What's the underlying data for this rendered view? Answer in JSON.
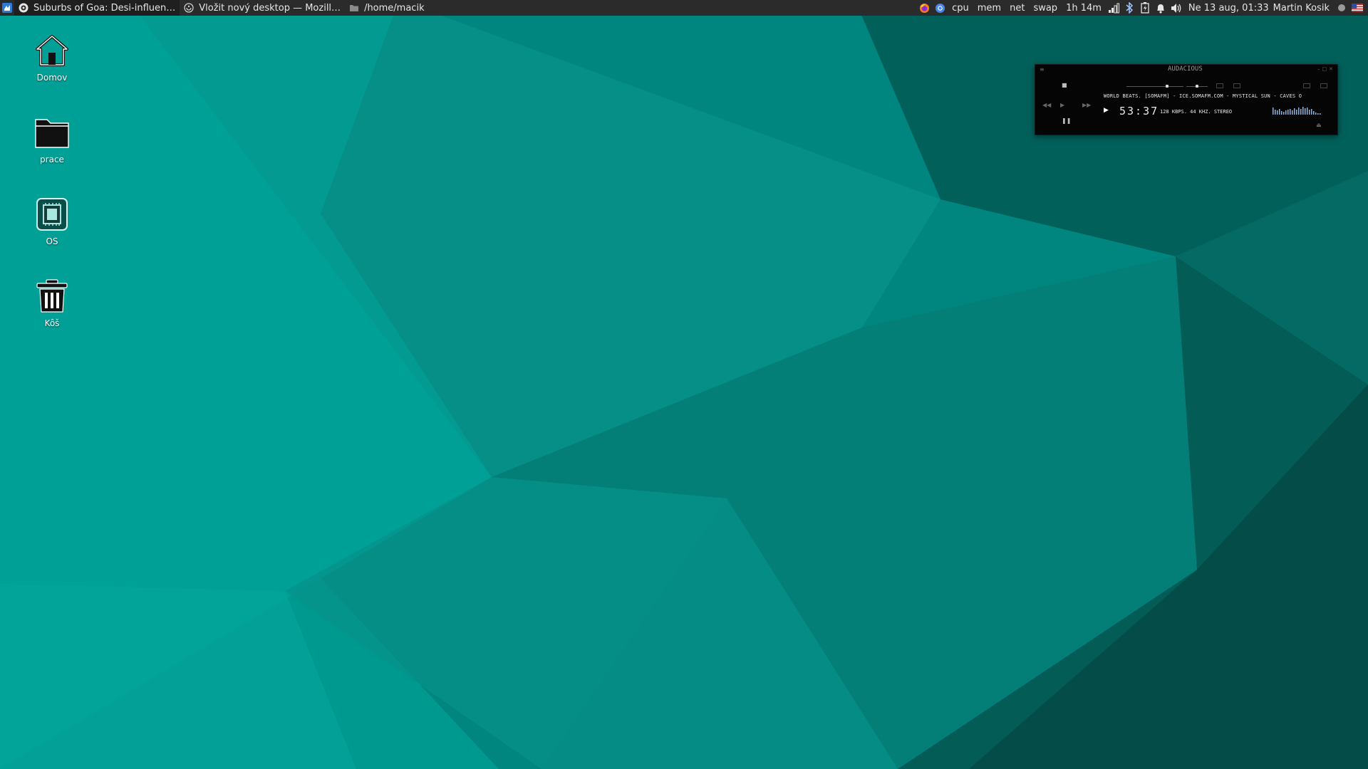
{
  "panel": {
    "tasks": [
      {
        "label": "Suburbs of Goa: Desi-influen…",
        "icon": "audacious-icon",
        "active": true
      },
      {
        "label": "Vložit nový desktop — Mozill…",
        "icon": "firefox-icon",
        "active": false
      },
      {
        "label": "/home/macik",
        "icon": "folder-icon",
        "active": false
      }
    ],
    "plugins": {
      "cpu": "cpu",
      "mem": "mem",
      "net": "net",
      "swap": "swap",
      "uptime": "1h 14m"
    },
    "tray_icons": [
      "firefox-icon",
      "chromium-icon",
      "signal-icon",
      "bluetooth-icon",
      "battery-icon",
      "bell-icon",
      "volume-icon"
    ],
    "clock": "Ne 13 aug, 01:33",
    "user": "Martin Kosik",
    "keyboard_flag": "us-flag-icon"
  },
  "desktop": {
    "icons": [
      {
        "label": "Domov",
        "icon": "home-icon"
      },
      {
        "label": "prace",
        "icon": "folder-icon"
      },
      {
        "label": "OS",
        "icon": "chip-icon"
      },
      {
        "label": "Kôš",
        "icon": "trash-icon"
      }
    ]
  },
  "player": {
    "logo": "AUDACIOUS",
    "marquee": "WORLD BEATS. [SOMAFM] - ICE.SOMAFM.COM - MYSTICAL SUN - CAVES O",
    "time": "53:37",
    "info": "128 KBPS. 44 KHZ. STEREO",
    "volume_fraction": 0.72,
    "balance_fraction": 0.5
  },
  "colors": {
    "wallpaper_base": "#00746c",
    "panel_bg": "#2b2b2b"
  }
}
